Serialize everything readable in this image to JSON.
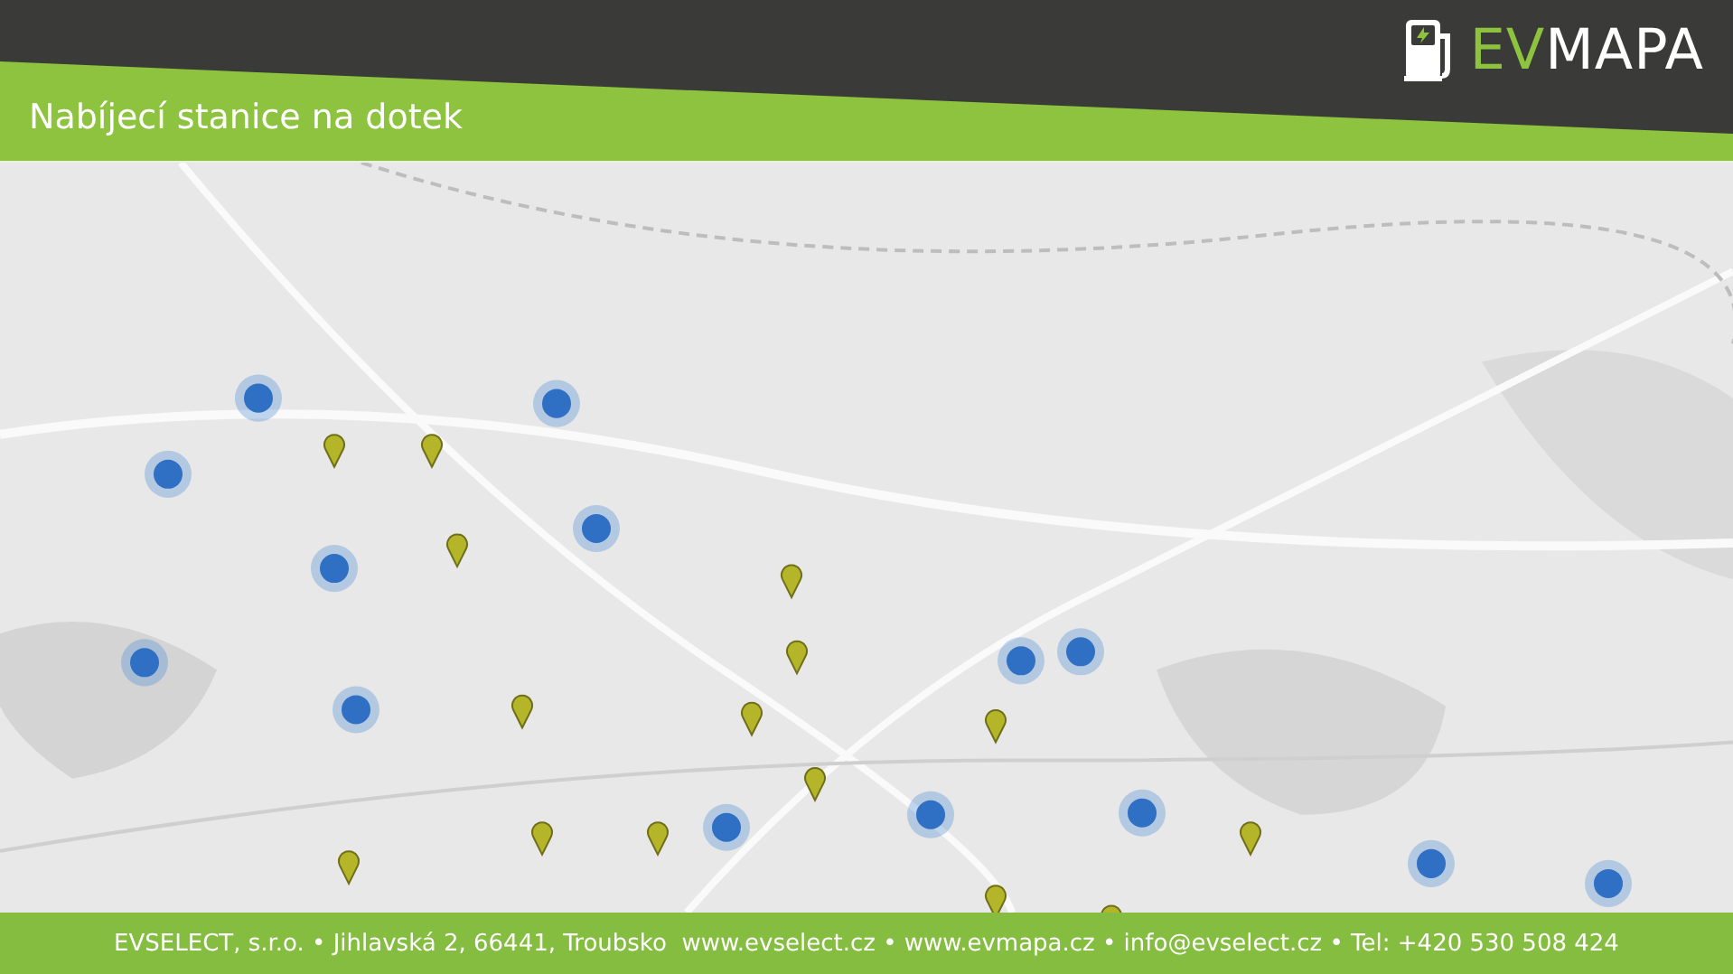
{
  "header": {
    "title": "Nabíjecí stanice na dotek",
    "logo": {
      "accent": "EV",
      "rest": "MAPA"
    }
  },
  "footer": {
    "text": "EVSELECT, s.r.o. • Jihlavská 2, 66441, Troubsko  www.evselect.cz • www.evmapa.cz • info@evselect.cz • Tel: +420 530 508 424"
  }
}
